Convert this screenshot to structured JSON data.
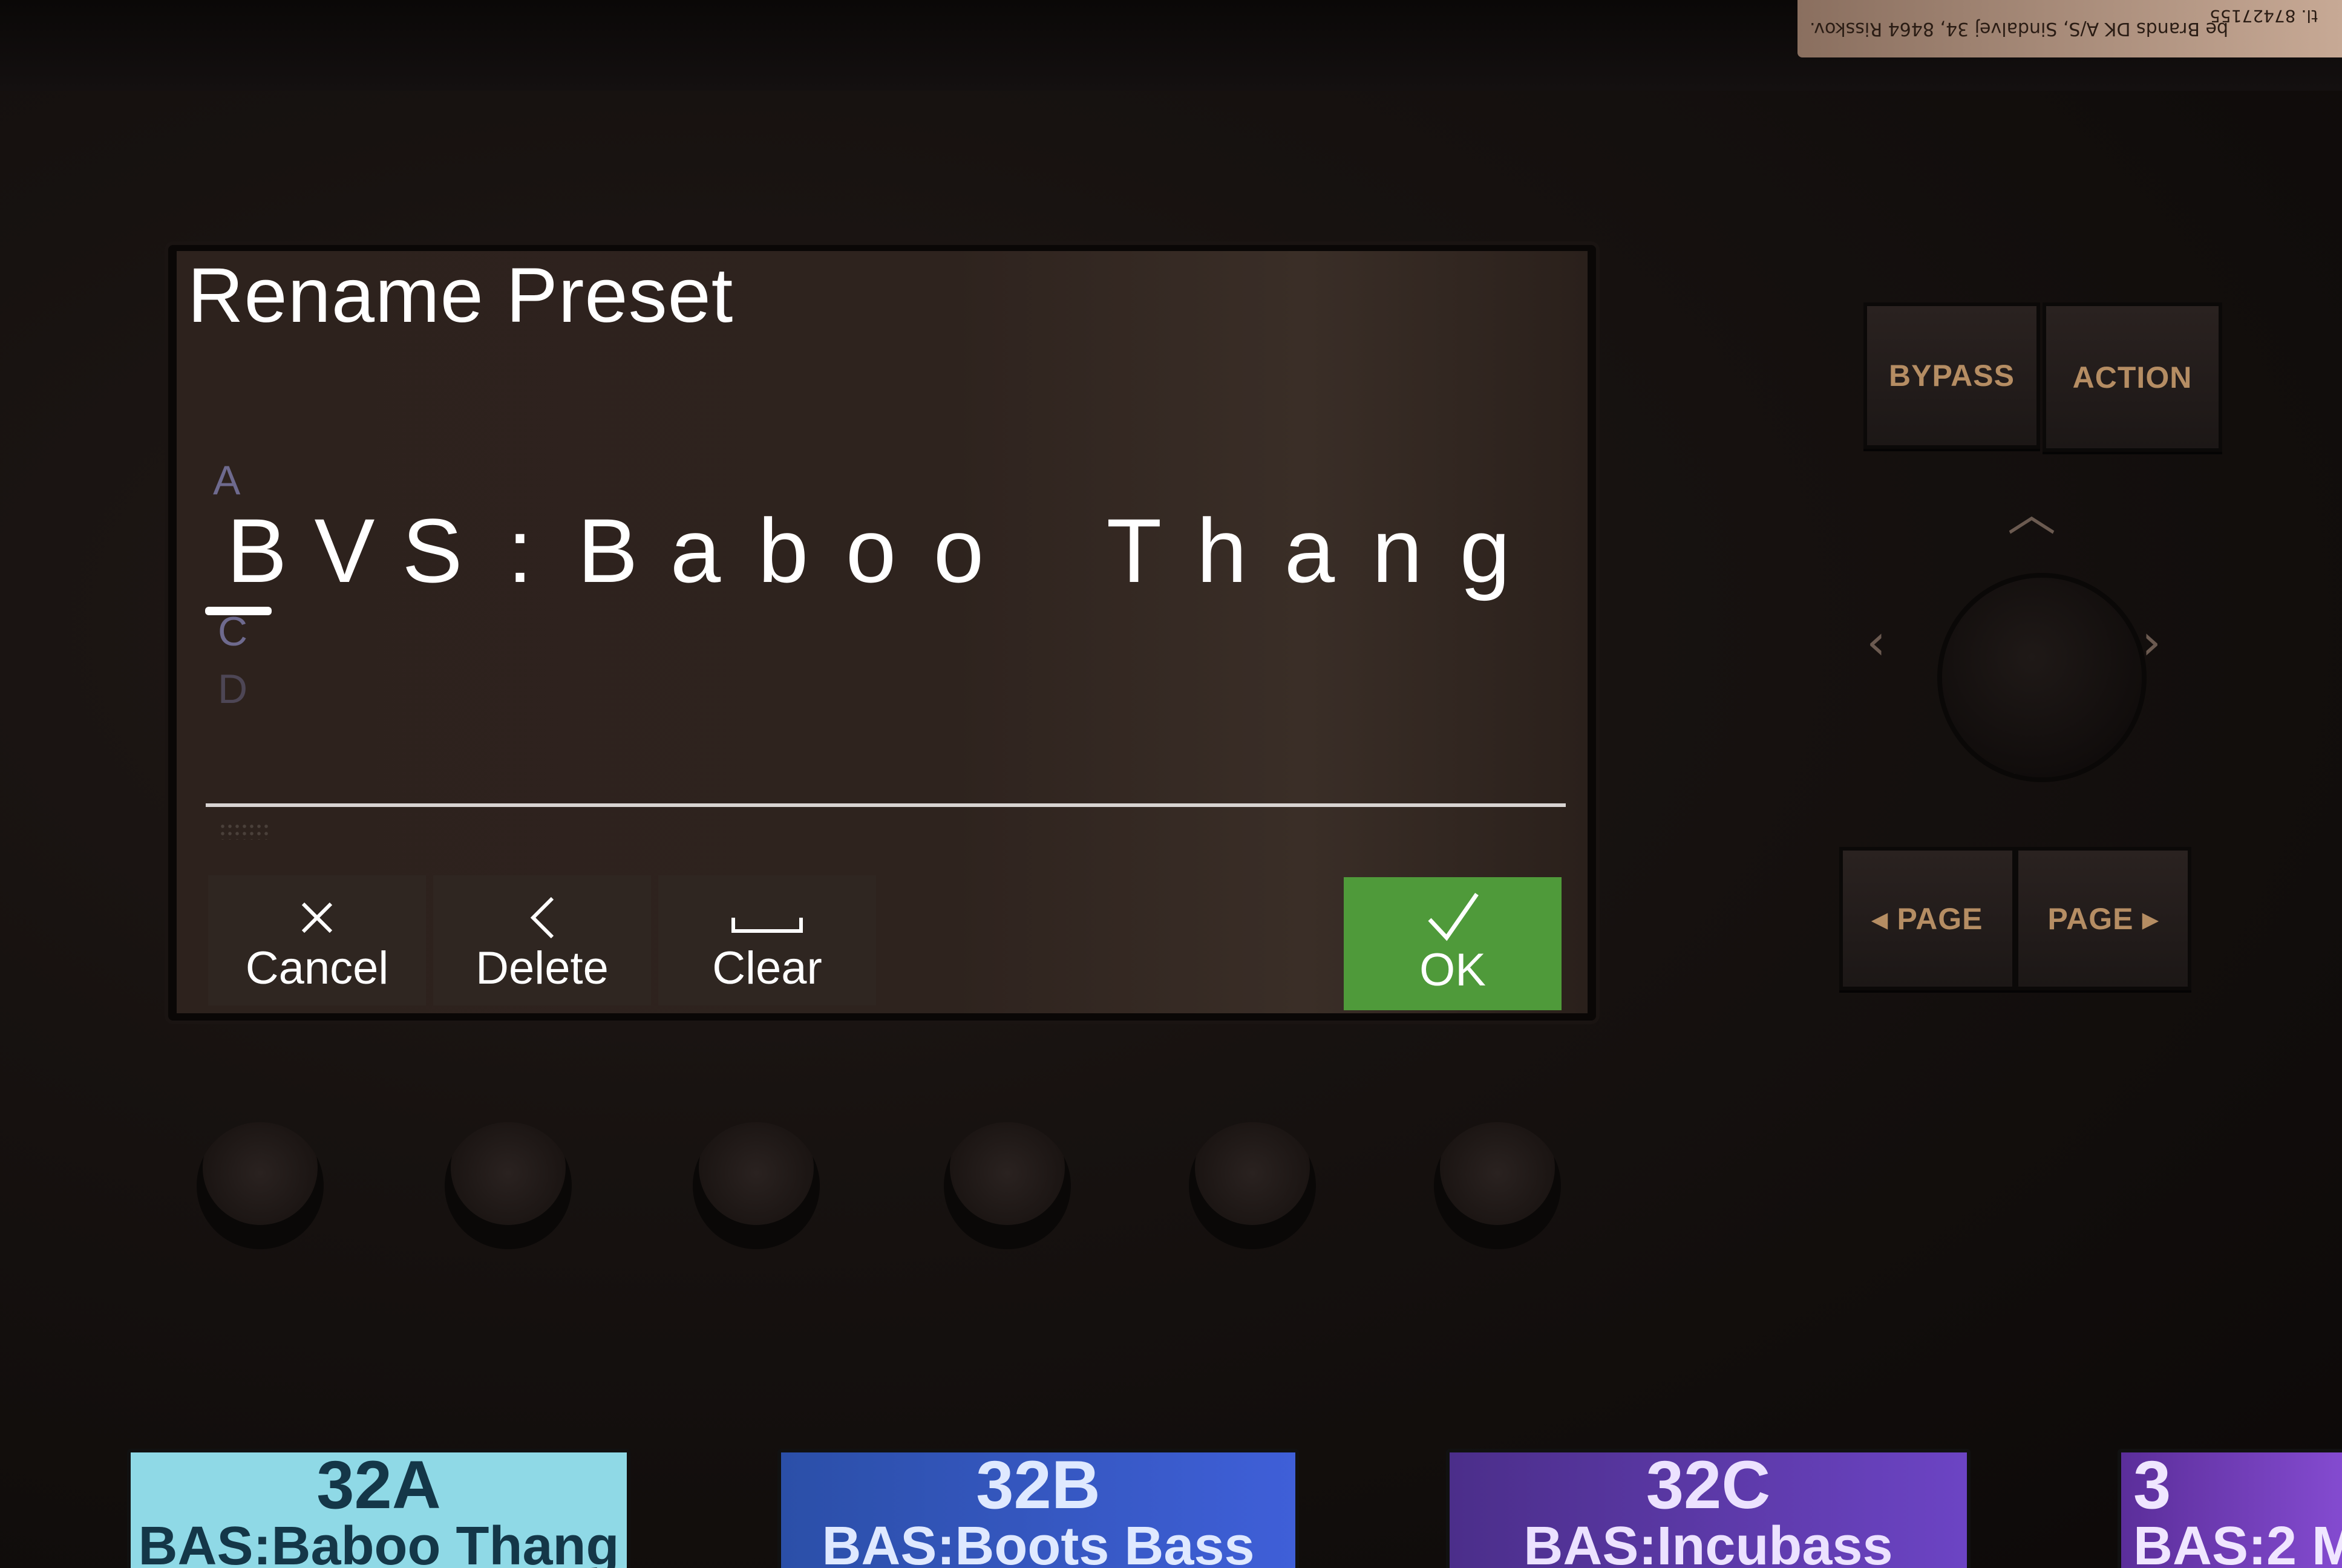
{
  "sticker": {
    "line1": "be Brands DK A/S, Sindalvej 34, 8464 Risskov.",
    "line2": "tl. 87427155"
  },
  "screen": {
    "title": "Rename Preset",
    "picker": {
      "prev_char": "A",
      "next_char": "C",
      "next_char_2": "D"
    },
    "name_chars": [
      "B",
      "V",
      "S",
      ":",
      "B",
      "a",
      "b",
      "o",
      "o",
      " ",
      "T",
      "h",
      "a",
      "n",
      "g"
    ],
    "buttons": {
      "cancel": "Cancel",
      "delete": "Delete",
      "clear": "Clear",
      "ok": "OK"
    },
    "colors": {
      "ok_bg": "#4f9a3a",
      "cursor": "#ffffff"
    }
  },
  "hardware": {
    "bypass": "BYPASS",
    "action": "ACTION",
    "page_prev": "◂ PAGE",
    "page_next": "PAGE ▸"
  },
  "scribbles": [
    {
      "num": "32A",
      "name": "BAS:Baboo Thang"
    },
    {
      "num": "32B",
      "name": "BAS:Boots Bass"
    },
    {
      "num": "32C",
      "name": "BAS:Incubass"
    },
    {
      "num": "3",
      "name": "BAS:2 M"
    }
  ]
}
